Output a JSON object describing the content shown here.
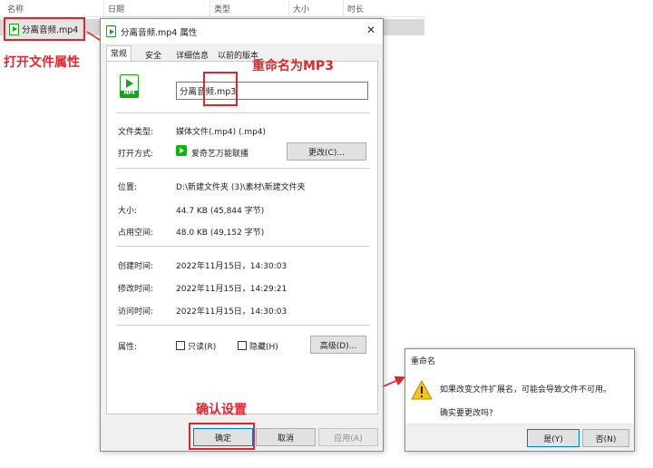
{
  "explorer": {
    "columns": [
      "名称",
      "日期",
      "类型",
      "大小",
      "时长"
    ],
    "file_name": "分离音频.mp4"
  },
  "annotations": {
    "open_props": "打开文件属性",
    "rename_to_mp3": "重命名为MP3",
    "confirm": "确认设置"
  },
  "props_dialog": {
    "title": "分离音频.mp4 属性",
    "close_glyph": "✕",
    "tabs": [
      "常规",
      "安全",
      "详细信息",
      "以前的版本"
    ],
    "file_icon_label": "MP4",
    "name_value": "分离音频.mp3",
    "file_type_label": "文件类型:",
    "file_type_value": "媒体文件(.mp4) (.mp4)",
    "open_with_label": "打开方式:",
    "open_with_value": "爱奇艺万能联播",
    "change_button": "更改(C)...",
    "location_label": "位置:",
    "location_value": "D:\\新建文件夹 (3)\\素材\\新建文件夹",
    "size_label": "大小:",
    "size_value": "44.7 KB (45,844 字节)",
    "disk_size_label": "占用空间:",
    "disk_size_value": "48.0 KB (49,152 字节)",
    "created_label": "创建时间:",
    "created_value": "2022年11月15日，14:30:03",
    "modified_label": "修改时间:",
    "modified_value": "2022年11月15日，14:29:21",
    "accessed_label": "访问时间:",
    "accessed_value": "2022年11月15日，14:30:03",
    "attributes_label": "属性:",
    "readonly_label": "只读(R)",
    "hidden_label": "隐藏(H)",
    "advanced_button": "高级(D)...",
    "ok_button": "确定",
    "cancel_button": "取消",
    "apply_button": "应用(A)"
  },
  "rename_dialog": {
    "title": "重命名",
    "message": "如果改变文件扩展名，可能会导致文件不可用。",
    "question": "确实要更改吗?",
    "yes_button": "是(Y)",
    "no_button": "否(N)"
  },
  "colors": {
    "annotation_red": "#e0262a",
    "accent_blue": "#0078d7",
    "file_green": "#1aa31a",
    "app_green": "#00be06",
    "warning_yellow": "#f5c518"
  }
}
